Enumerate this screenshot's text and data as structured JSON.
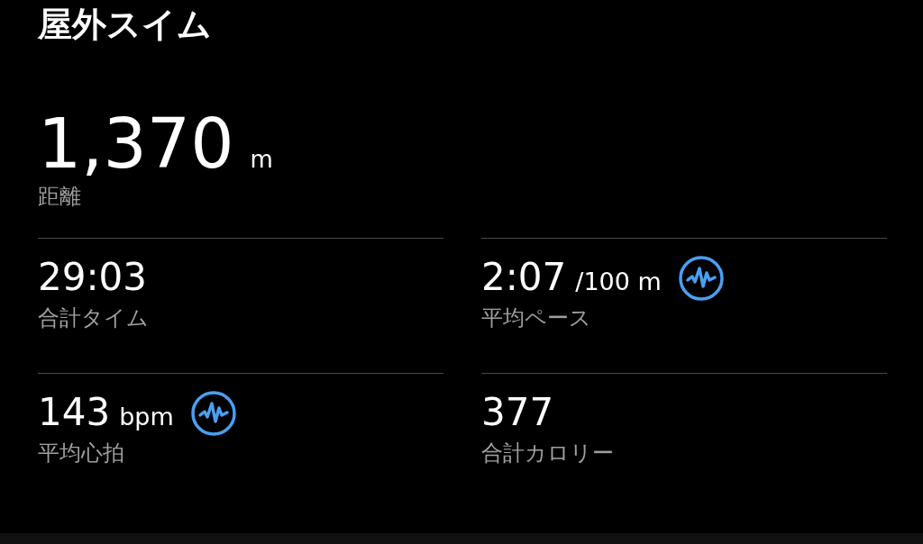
{
  "title": "屋外スイム",
  "headline": {
    "value": "1,370",
    "unit": "m",
    "label": "距離"
  },
  "stats": [
    {
      "value": "29:03",
      "label": "合計タイム",
      "detail": false
    },
    {
      "value": "2:07",
      "unit": "/100 m",
      "label": "平均ペース",
      "detail": true
    },
    {
      "value": "143",
      "unit": "bpm",
      "label": "平均心拍",
      "detail": true
    },
    {
      "value": "377",
      "label": "合計カロリー",
      "detail": false
    }
  ]
}
